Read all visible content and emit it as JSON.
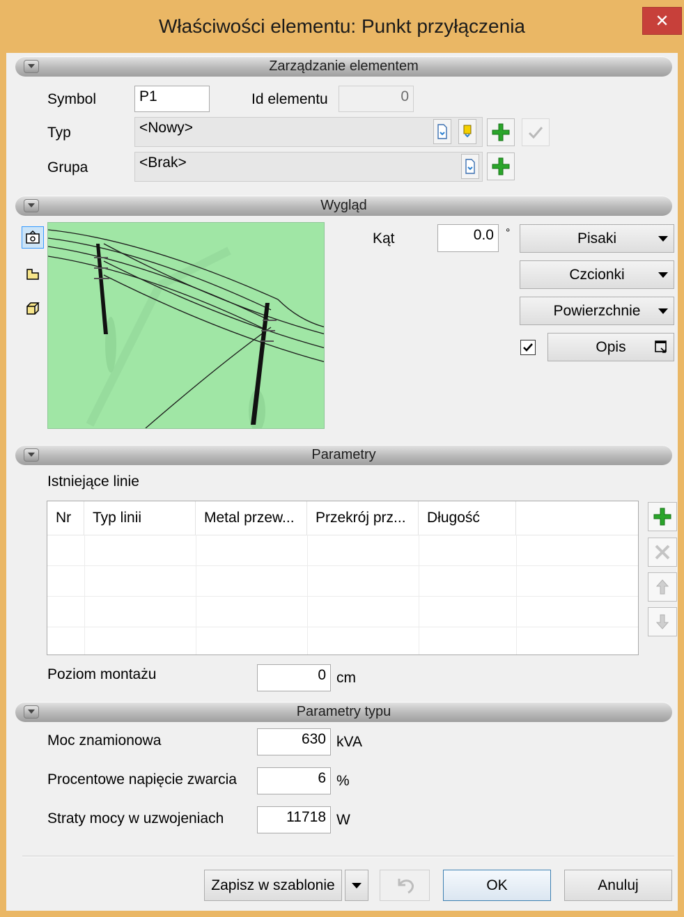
{
  "window": {
    "title": "Właściwości elementu: Punkt przyłączenia",
    "close_glyph": "✕"
  },
  "sections": {
    "management": "Zarządzanie elementem",
    "appearance": "Wygląd",
    "parameters": "Parametry",
    "type_parameters": "Parametry typu"
  },
  "management": {
    "symbol_label": "Symbol",
    "symbol_value": "P1",
    "id_label": "Id elementu",
    "id_value": "0",
    "type_label": "Typ",
    "type_value": "<Nowy>",
    "group_label": "Grupa",
    "group_value": "<Brak>"
  },
  "appearance": {
    "angle_label": "Kąt",
    "angle_value": "0.0",
    "angle_unit": "°",
    "pens_label": "Pisaki",
    "fonts_label": "Czcionki",
    "surfaces_label": "Powierzchnie",
    "description_label": "Opis",
    "description_checked": true,
    "view_tools": [
      "view-3d-icon",
      "view-2d-icon",
      "view-box-icon"
    ]
  },
  "parameters": {
    "existing_lines_label": "Istniejące linie",
    "columns": [
      "Nr",
      "Typ linii",
      "Metal przew...",
      "Przekrój prz...",
      "Długość"
    ],
    "rows": [],
    "mount_level_label": "Poziom montażu",
    "mount_level_value": "0",
    "mount_level_unit": "cm"
  },
  "type_parameters": {
    "rated_power_label": "Moc znamionowa",
    "rated_power_value": "630",
    "rated_power_unit": "kVA",
    "short_circuit_label": "Procentowe napięcie zwarcia",
    "short_circuit_value": "6",
    "short_circuit_unit": "%",
    "winding_losses_label": "Straty mocy w uzwojeniach",
    "winding_losses_value": "11718",
    "winding_losses_unit": "W"
  },
  "footer": {
    "save_template_label": "Zapisz w szablonie",
    "ok_label": "OK",
    "cancel_label": "Anuluj"
  },
  "colors": {
    "window_frame": "#eab765",
    "close_button": "#c7403a",
    "preview_background": "#a0e6a5",
    "add_icon_green": "#2aa52a"
  }
}
